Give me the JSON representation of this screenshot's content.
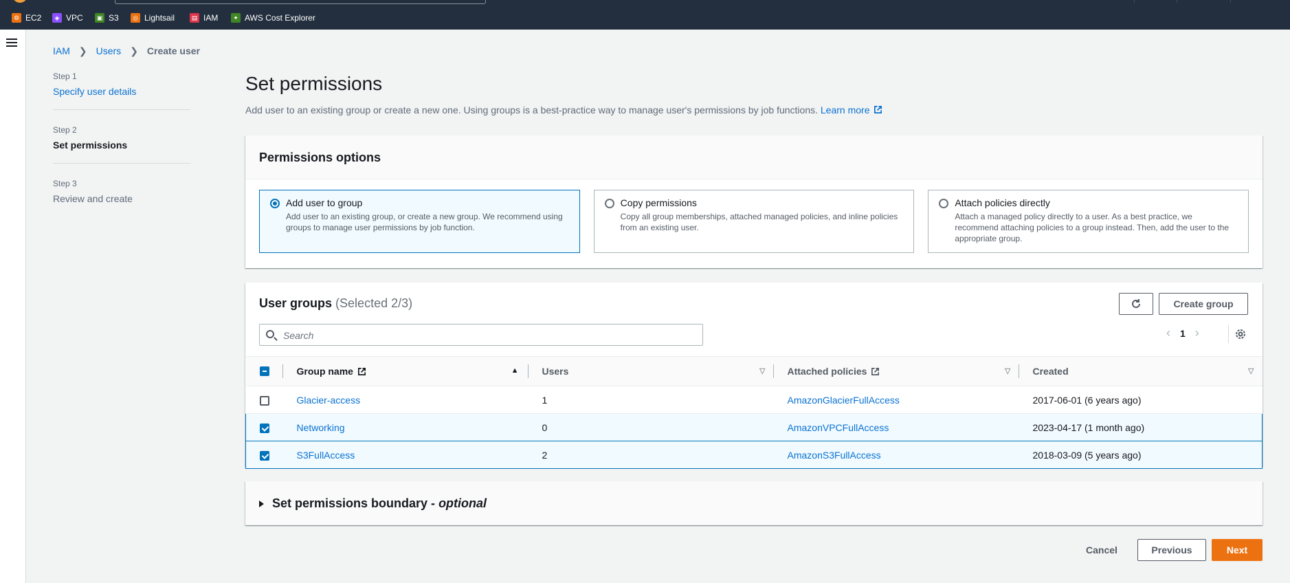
{
  "topbar": {
    "favorites": [
      {
        "label": "EC2",
        "icon": "ec2-icon",
        "color": "#ec7211"
      },
      {
        "label": "VPC",
        "icon": "vpc-icon",
        "color": "#8c4fff"
      },
      {
        "label": "S3",
        "icon": "s3-icon",
        "color": "#3f8624"
      },
      {
        "label": "Lightsail",
        "icon": "lightsail-icon",
        "color": "#ec7211"
      },
      {
        "label": "IAM",
        "icon": "iam-icon",
        "color": "#dd344c"
      },
      {
        "label": "AWS Cost Explorer",
        "icon": "cost-explorer-icon",
        "color": "#3f8624"
      }
    ]
  },
  "breadcrumb": {
    "items": [
      "IAM",
      "Users"
    ],
    "current": "Create user"
  },
  "steps": [
    {
      "num": "Step 1",
      "title": "Specify user details",
      "state": "link"
    },
    {
      "num": "Step 2",
      "title": "Set permissions",
      "state": "active"
    },
    {
      "num": "Step 3",
      "title": "Review and create",
      "state": "disabled"
    }
  ],
  "page": {
    "title": "Set permissions",
    "description": "Add user to an existing group or create a new one. Using groups is a best-practice way to manage user's permissions by job functions.",
    "learn_more": "Learn more"
  },
  "permissions_options": {
    "header": "Permissions options",
    "options": [
      {
        "title": "Add user to group",
        "desc": "Add user to an existing group, or create a new group. We recommend using groups to manage user permissions by job function.",
        "selected": true
      },
      {
        "title": "Copy permissions",
        "desc": "Copy all group memberships, attached managed policies, and inline policies from an existing user.",
        "selected": false
      },
      {
        "title": "Attach policies directly",
        "desc": "Attach a managed policy directly to a user. As a best practice, we recommend attaching policies to a group instead. Then, add the user to the appropriate group.",
        "selected": false
      }
    ]
  },
  "user_groups": {
    "title": "User groups",
    "count": "(Selected 2/3)",
    "create_group_label": "Create group",
    "search_placeholder": "Search",
    "page": "1",
    "columns": [
      "Group name",
      "Users",
      "Attached policies",
      "Created"
    ],
    "rows": [
      {
        "name": "Glacier-access",
        "users": "1",
        "policy": "AmazonGlacierFullAccess",
        "created": "2017-06-01 (6 years ago)",
        "selected": false
      },
      {
        "name": "Networking",
        "users": "0",
        "policy": "AmazonVPCFullAccess",
        "created": "2023-04-17 (1 month ago)",
        "selected": true
      },
      {
        "name": "S3FullAccess",
        "users": "2",
        "policy": "AmazonS3FullAccess",
        "created": "2018-03-09 (5 years ago)",
        "selected": true
      }
    ]
  },
  "boundary": {
    "title": "Set permissions boundary - ",
    "optional": "optional"
  },
  "footer": {
    "cancel": "Cancel",
    "previous": "Previous",
    "next": "Next"
  },
  "colors": {
    "accent": "#0073bb",
    "primary_button": "#ec7211",
    "topbar": "#232f3e"
  }
}
